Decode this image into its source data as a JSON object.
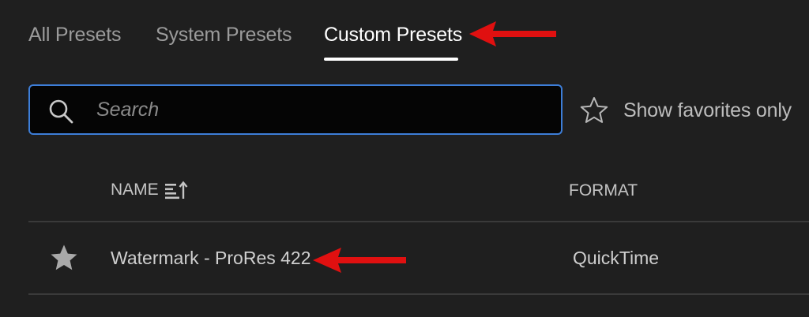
{
  "tabs": [
    {
      "label": "All Presets",
      "active": false
    },
    {
      "label": "System Presets",
      "active": false
    },
    {
      "label": "Custom Presets",
      "active": true
    }
  ],
  "search": {
    "placeholder": "Search",
    "value": "",
    "icon": "search-icon"
  },
  "favorites_toggle": {
    "label": "Show favorites only",
    "icon": "star-outline-icon",
    "checked": false
  },
  "table": {
    "columns": [
      {
        "label": "NAME",
        "sort": "ascending",
        "sort_icon": "sort-ascending-icon"
      },
      {
        "label": "FORMAT"
      }
    ],
    "rows": [
      {
        "favorite": true,
        "name": "Watermark - ProRes 422",
        "format": "QuickTime"
      }
    ]
  },
  "annotations": {
    "arrow_color": "#e01010",
    "arrows": [
      "arrow-to-custom-presets-tab",
      "arrow-to-preset-row"
    ]
  },
  "colors": {
    "background": "#1f1f1f",
    "accent": "#3d7ed8",
    "active_tab": "#ffffff",
    "inactive_tab": "#9b9b9b"
  }
}
